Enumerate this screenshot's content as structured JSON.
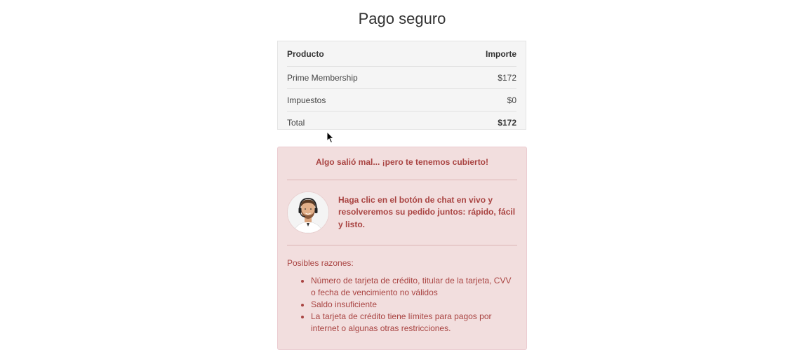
{
  "page": {
    "title": "Pago seguro"
  },
  "order": {
    "header": {
      "product": "Producto",
      "amount": "Importe"
    },
    "rows": [
      {
        "label": "Prime Membership",
        "amount": "$172"
      },
      {
        "label": "Impuestos",
        "amount": "$0"
      }
    ],
    "total": {
      "label": "Total",
      "amount": "$172"
    }
  },
  "alert": {
    "heading": "Algo salió mal... ¡pero te tenemos cubierto!",
    "agent_message": "Haga clic en el botón de chat en vivo y resolveremos su pedido juntos: rápido, fácil y listo.",
    "reasons_title": "Posibles razones:",
    "reasons": [
      "Número de tarjeta de crédito, titular de la tarjeta, CVV o fecha de vencimiento no válidos",
      "Saldo insuficiente",
      "La tarjeta de crédito tiene límites para pagos por internet o algunas otras restricciones."
    ]
  },
  "colors": {
    "alert_background": "#f2dede",
    "alert_text": "#a94442",
    "table_background": "#f5f5f5"
  },
  "icons": {
    "avatar": "support-agent-avatar",
    "cursor": "mouse-pointer-icon"
  }
}
